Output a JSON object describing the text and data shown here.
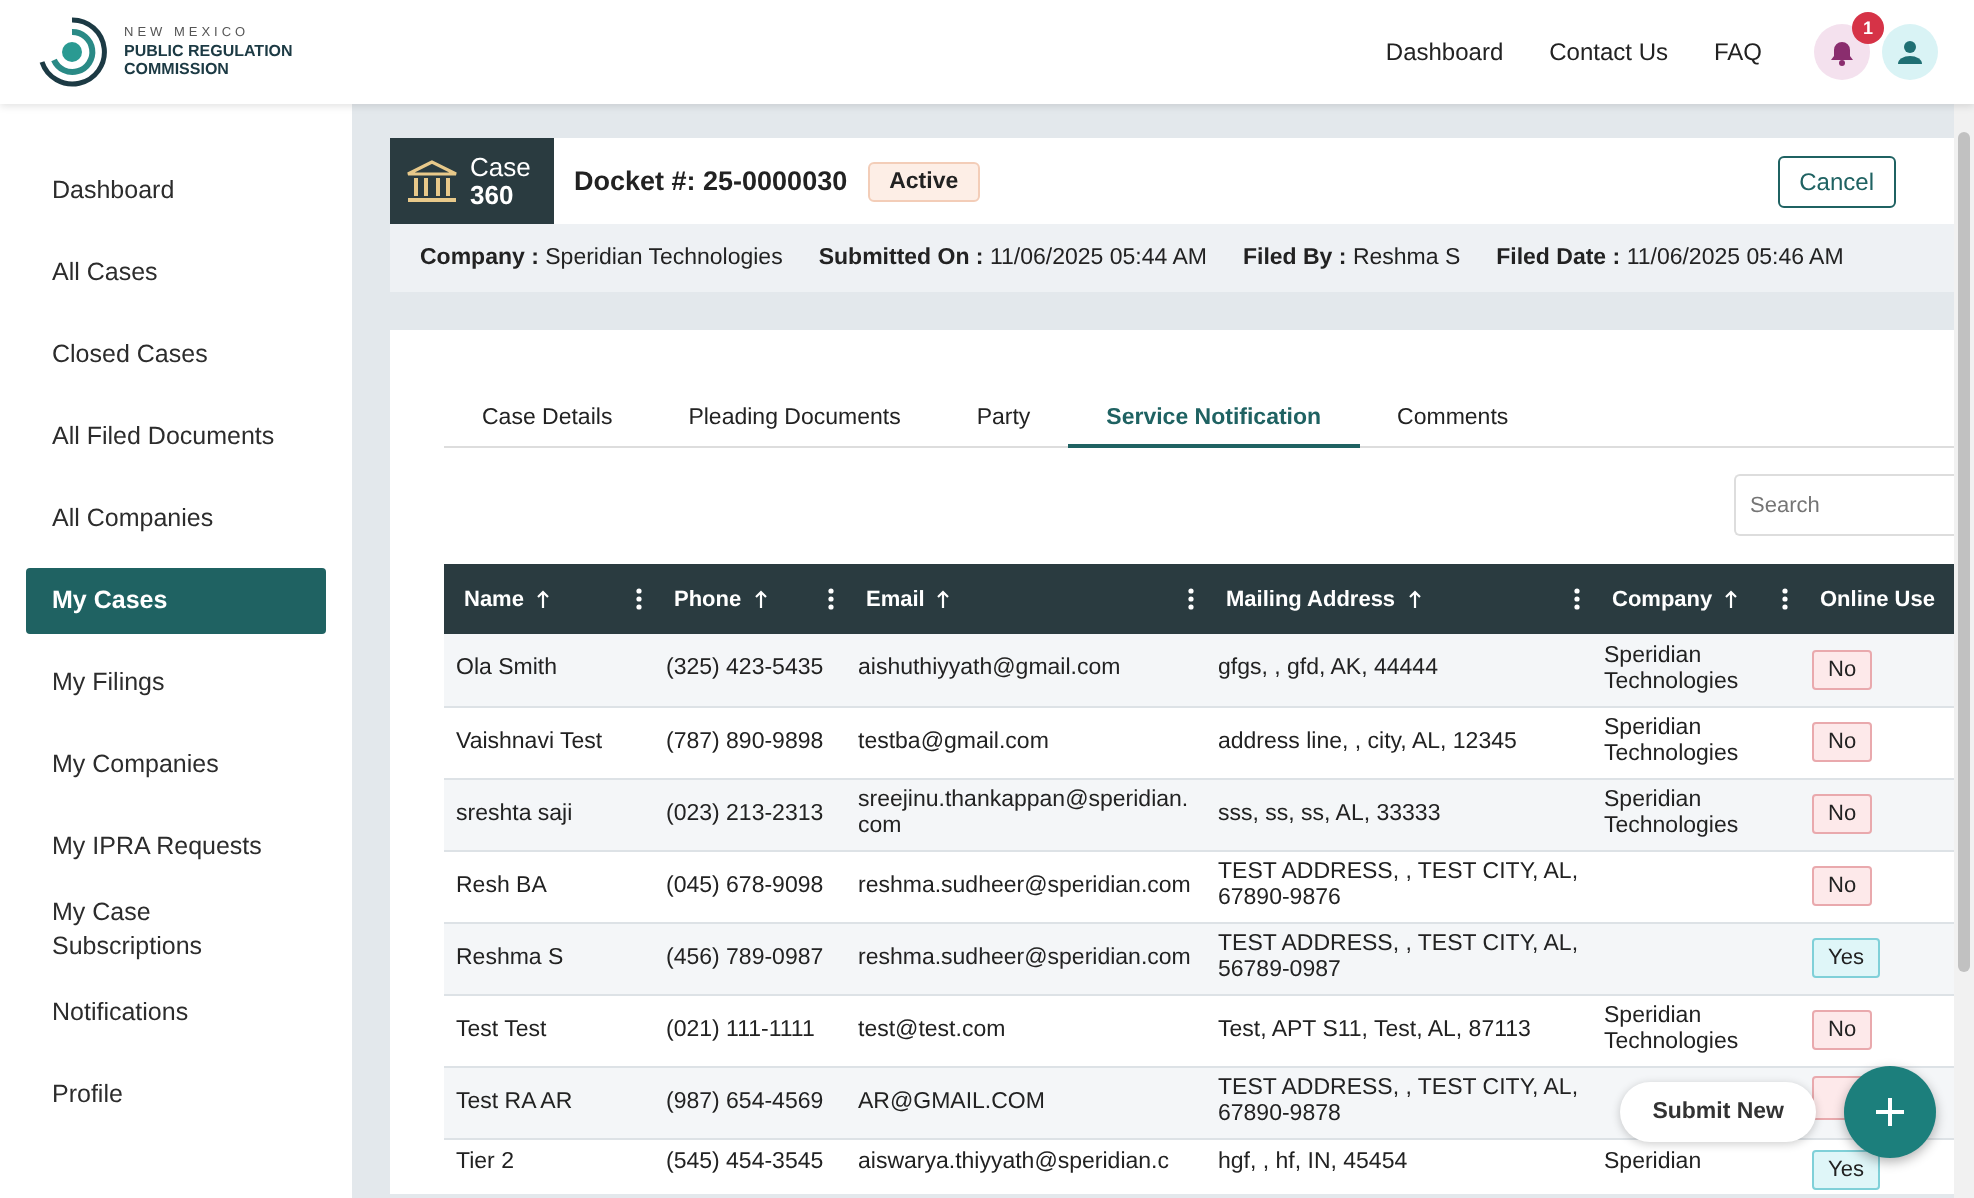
{
  "header": {
    "logo": {
      "line1": "NEW MEXICO",
      "line2": "PUBLIC REGULATION",
      "line3": "COMMISSION"
    },
    "nav": [
      "Dashboard",
      "Contact Us",
      "FAQ"
    ],
    "notifications": {
      "count": "1"
    }
  },
  "sidebar": {
    "items": [
      {
        "label": "Dashboard",
        "selected": false
      },
      {
        "label": "All Cases",
        "selected": false
      },
      {
        "label": "Closed Cases",
        "selected": false
      },
      {
        "label": "All Filed Documents",
        "selected": false
      },
      {
        "label": "All Companies",
        "selected": false
      },
      {
        "label": "My Cases",
        "selected": true
      },
      {
        "label": "My Filings",
        "selected": false
      },
      {
        "label": "My Companies",
        "selected": false
      },
      {
        "label": "My IPRA Requests",
        "selected": false
      },
      {
        "label": "My Case Subscriptions",
        "selected": false
      },
      {
        "label": "Notifications",
        "selected": false
      },
      {
        "label": "Profile",
        "selected": false
      }
    ]
  },
  "case": {
    "badge_title": "Case",
    "badge_number": "360",
    "docket": "Docket #: 25-0000030",
    "status": "Active",
    "cancel_button": "Cancel",
    "info": [
      {
        "label": "Company :",
        "value": "Speridian Technologies"
      },
      {
        "label": "Submitted On :",
        "value": "11/06/2025 05:44 AM"
      },
      {
        "label": "Filed By :",
        "value": "Reshma S"
      },
      {
        "label": "Filed Date :",
        "value": "11/06/2025 05:46 AM"
      }
    ]
  },
  "tabs": [
    {
      "label": "Case Details",
      "selected": false
    },
    {
      "label": "Pleading Documents",
      "selected": false
    },
    {
      "label": "Party",
      "selected": false
    },
    {
      "label": "Service Notification",
      "selected": true
    },
    {
      "label": "Comments",
      "selected": false
    }
  ],
  "search": {
    "placeholder": "Search"
  },
  "table": {
    "columns": [
      {
        "label": "Name",
        "sortable": true,
        "menu": true
      },
      {
        "label": "Phone",
        "sortable": true,
        "menu": true
      },
      {
        "label": "Email",
        "sortable": true,
        "menu": true
      },
      {
        "label": "Mailing Address",
        "sortable": true,
        "menu": true
      },
      {
        "label": "Company",
        "sortable": true,
        "menu": true
      },
      {
        "label": "Online Use"
      }
    ],
    "rows": [
      {
        "name": "Ola Smith",
        "phone": "(325) 423-5435",
        "email": "aishuthiyyath@gmail.com",
        "address": "gfgs, , gfd, AK, 44444",
        "company": "Speridian Technologies",
        "online": {
          "label": "No",
          "kind": "negative"
        }
      },
      {
        "name": "Vaishnavi Test",
        "phone": "(787) 890-9898",
        "email": "testba@gmail.com",
        "address": "address line, , city, AL, 12345",
        "company": "Speridian Technologies",
        "online": {
          "label": "No",
          "kind": "negative"
        }
      },
      {
        "name": "sreshta saji",
        "phone": "(023) 213-2313",
        "email": "sreejinu.thankappan@speridian.com",
        "address": "sss, ss, ss, AL, 33333",
        "company": "Speridian Technologies",
        "online": {
          "label": "No",
          "kind": "negative"
        }
      },
      {
        "name": "Resh BA",
        "phone": "(045) 678-9098",
        "email": "reshma.sudheer@speridian.com",
        "address": "TEST ADDRESS, , TEST CITY, AL, 67890-9876",
        "online": {
          "label": "No",
          "kind": "negative"
        }
      },
      {
        "name": "Reshma S",
        "phone": "(456) 789-0987",
        "email": "reshma.sudheer@speridian.com",
        "address": "TEST ADDRESS, , TEST CITY, AL, 56789-0987",
        "online": {
          "label": "Yes",
          "kind": "positive"
        }
      },
      {
        "name": "Test Test",
        "phone": "(021) 111-1111",
        "email": "test@test.com",
        "address": "Test, APT S11, Test, AL, 87113",
        "company": "Speridian Technologies",
        "online": {
          "label": "No",
          "kind": "negative"
        }
      },
      {
        "name": "Test RA AR",
        "phone": "(987) 654-4569",
        "email": "AR@GMAIL.COM",
        "address": "TEST ADDRESS, , TEST CITY, AL, 67890-9878",
        "online": {
          "kind": "negative"
        }
      },
      {
        "name": "Tier 2",
        "phone": "(545) 454-3545",
        "email": "aiswarya.thiyyath@speridian.c",
        "address": "hgf, , hf, IN, 45454",
        "company": "Speridian",
        "online": {
          "label": "Yes",
          "kind": "positive"
        }
      }
    ]
  },
  "submit_new": {
    "label": "Submit New"
  }
}
